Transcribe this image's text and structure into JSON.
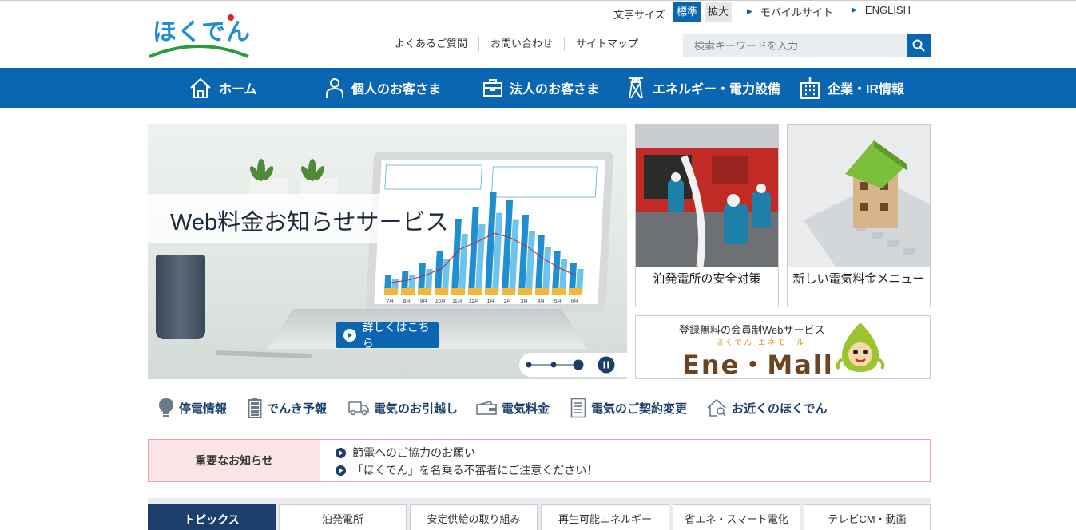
{
  "header": {
    "logo_text": "ほくでん",
    "font_size_label": "文字サイズ",
    "font_size_standard": "標準",
    "font_size_large": "拡大",
    "mobile_site": "モバイルサイト",
    "english": "ENGLISH",
    "sublinks": [
      "よくあるご質問",
      "お問い合わせ",
      "サイトマップ"
    ],
    "search_placeholder": "検索キーワードを入力"
  },
  "nav": [
    {
      "label": "ホーム",
      "icon": "home-icon"
    },
    {
      "label": "個人のお客さま",
      "icon": "person-icon"
    },
    {
      "label": "法人のお客さま",
      "icon": "briefcase-icon"
    },
    {
      "label": "エネルギー・電力設備",
      "icon": "power-tower-icon"
    },
    {
      "label": "企業・IR情報",
      "icon": "building-icon"
    }
  ],
  "hero": {
    "title": "Web料金お知らせサービス",
    "button": "詳しくはこちら",
    "slide_count": 3,
    "active_slide": 3,
    "chart_months": [
      "7月",
      "8月",
      "9月",
      "10月",
      "11月",
      "12月",
      "1月",
      "2月",
      "3月",
      "4月",
      "5月",
      "6月"
    ]
  },
  "tiles": [
    {
      "label": "泊発電所の安全対策"
    },
    {
      "label": "新しい電気料金メニュー"
    }
  ],
  "enemall": {
    "subtitle": "登録無料の会員制Webサービス",
    "kana": "ほくでん エネモール",
    "logo": "Ene・Mall"
  },
  "quick_links": [
    {
      "label": "停電情報",
      "icon": "lightbulb-icon"
    },
    {
      "label": "でんき予報",
      "icon": "battery-icon"
    },
    {
      "label": "電気のお引越し",
      "icon": "truck-icon"
    },
    {
      "label": "電気料金",
      "icon": "wallet-icon"
    },
    {
      "label": "電気のご契約変更",
      "icon": "document-icon"
    },
    {
      "label": "お近くのほくでん",
      "icon": "location-house-icon"
    }
  ],
  "notice": {
    "label": "重要なお知らせ",
    "items": [
      "節電へのご協力のお願い",
      "「ほくでん」を名乗る不審者にご注意ください！"
    ]
  },
  "tabs": [
    "トピックス",
    "泊発電所",
    "安定供給の取り組み",
    "再生可能エネルギー",
    "省エネ・スマート電化",
    "テレビCM・動画"
  ],
  "colors": {
    "primary": "#0a66b1",
    "navy": "#1b3e6b",
    "notice_bg": "#fbe4e8",
    "logo_green": "#2a9d3a",
    "logo_red": "#e4202d"
  }
}
